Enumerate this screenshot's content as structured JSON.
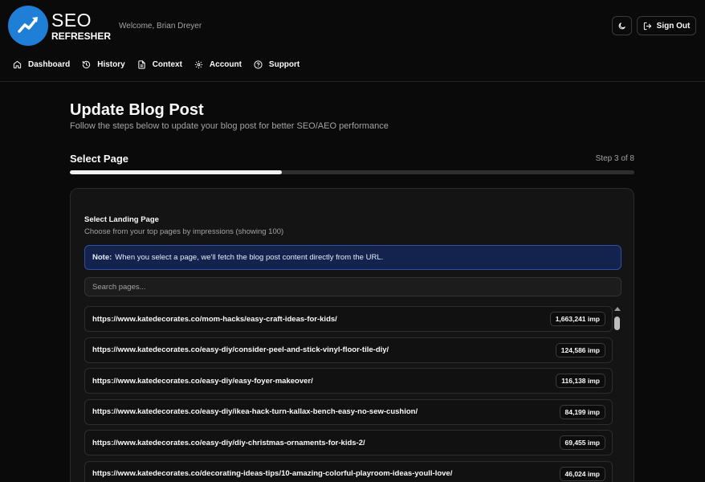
{
  "header": {
    "logo_top": "SEO",
    "logo_bottom": "REFRESHER",
    "welcome": "Welcome, Brian Dreyer",
    "sign_out_label": "Sign Out",
    "theme_icon": "moon-icon",
    "sign_out_icon": "log-out-icon"
  },
  "nav": {
    "items": [
      {
        "label": "Dashboard",
        "icon": "home-icon"
      },
      {
        "label": "History",
        "icon": "history-icon"
      },
      {
        "label": "Context",
        "icon": "document-icon"
      },
      {
        "label": "Account",
        "icon": "gear-icon"
      },
      {
        "label": "Support",
        "icon": "help-circle-icon"
      }
    ]
  },
  "page": {
    "title": "Update Blog Post",
    "subtitle": "Follow the steps below to update your blog post for better SEO/AEO performance",
    "step_title": "Select Page",
    "step_counter": "Step 3 of 8",
    "progress": 0.375
  },
  "card": {
    "title": "Select Landing Page",
    "subtitle": "Choose from your top pages by impressions (showing 100)",
    "note_label": "Note:",
    "note_text": "When you select a page, we'll fetch the blog post content directly from the URL.",
    "search_placeholder": "Search pages...",
    "pages": [
      {
        "url": "https://www.katedecorates.co/mom-hacks/easy-craft-ideas-for-kids/",
        "impressions": "1,663,241 imp"
      },
      {
        "url": "https://www.katedecorates.co/easy-diy/consider-peel-and-stick-vinyl-floor-tile-diy/",
        "impressions": "124,586 imp"
      },
      {
        "url": "https://www.katedecorates.co/easy-diy/easy-foyer-makeover/",
        "impressions": "116,138 imp"
      },
      {
        "url": "https://www.katedecorates.co/easy-diy/ikea-hack-turn-kallax-bench-easy-no-sew-cushion/",
        "impressions": "84,199 imp"
      },
      {
        "url": "https://www.katedecorates.co/easy-diy/diy-christmas-ornaments-for-kids-2/",
        "impressions": "69,455 imp"
      },
      {
        "url": "https://www.katedecorates.co/decorating-ideas-tips/10-amazing-colorful-playroom-ideas-youll-love/",
        "impressions": "46,024 imp"
      }
    ]
  },
  "colors": {
    "background": "#0a0a0a",
    "card": "#141414",
    "accent_blue": "#1f7fd6",
    "note_bg": "#13234d",
    "note_border": "#2d4fa8"
  }
}
